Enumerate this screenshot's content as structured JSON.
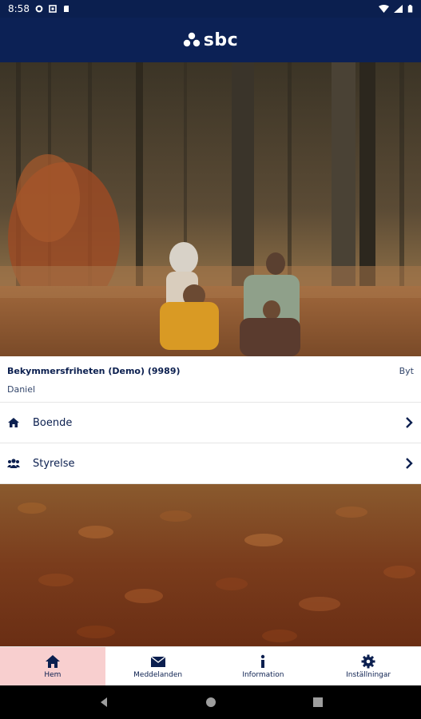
{
  "status_bar": {
    "time": "8:58"
  },
  "header": {
    "logo_text": "sbc"
  },
  "info_card": {
    "org_name": "Bekymmersfriheten (Demo) (9989)",
    "user_name": "Daniel",
    "switch_label": "Byt"
  },
  "menu": [
    {
      "label": "Boende",
      "icon": "home-icon"
    },
    {
      "label": "Styrelse",
      "icon": "users-icon"
    }
  ],
  "bottom_nav": [
    {
      "label": "Hem",
      "icon": "home-icon",
      "active": true
    },
    {
      "label": "Meddelanden",
      "icon": "envelope-icon",
      "active": false
    },
    {
      "label": "Information",
      "icon": "info-icon",
      "active": false
    },
    {
      "label": "Inställningar",
      "icon": "gear-icon",
      "active": false
    }
  ],
  "colors": {
    "navy": "#0c2155",
    "active_tab_bg": "#f8cfcf"
  }
}
